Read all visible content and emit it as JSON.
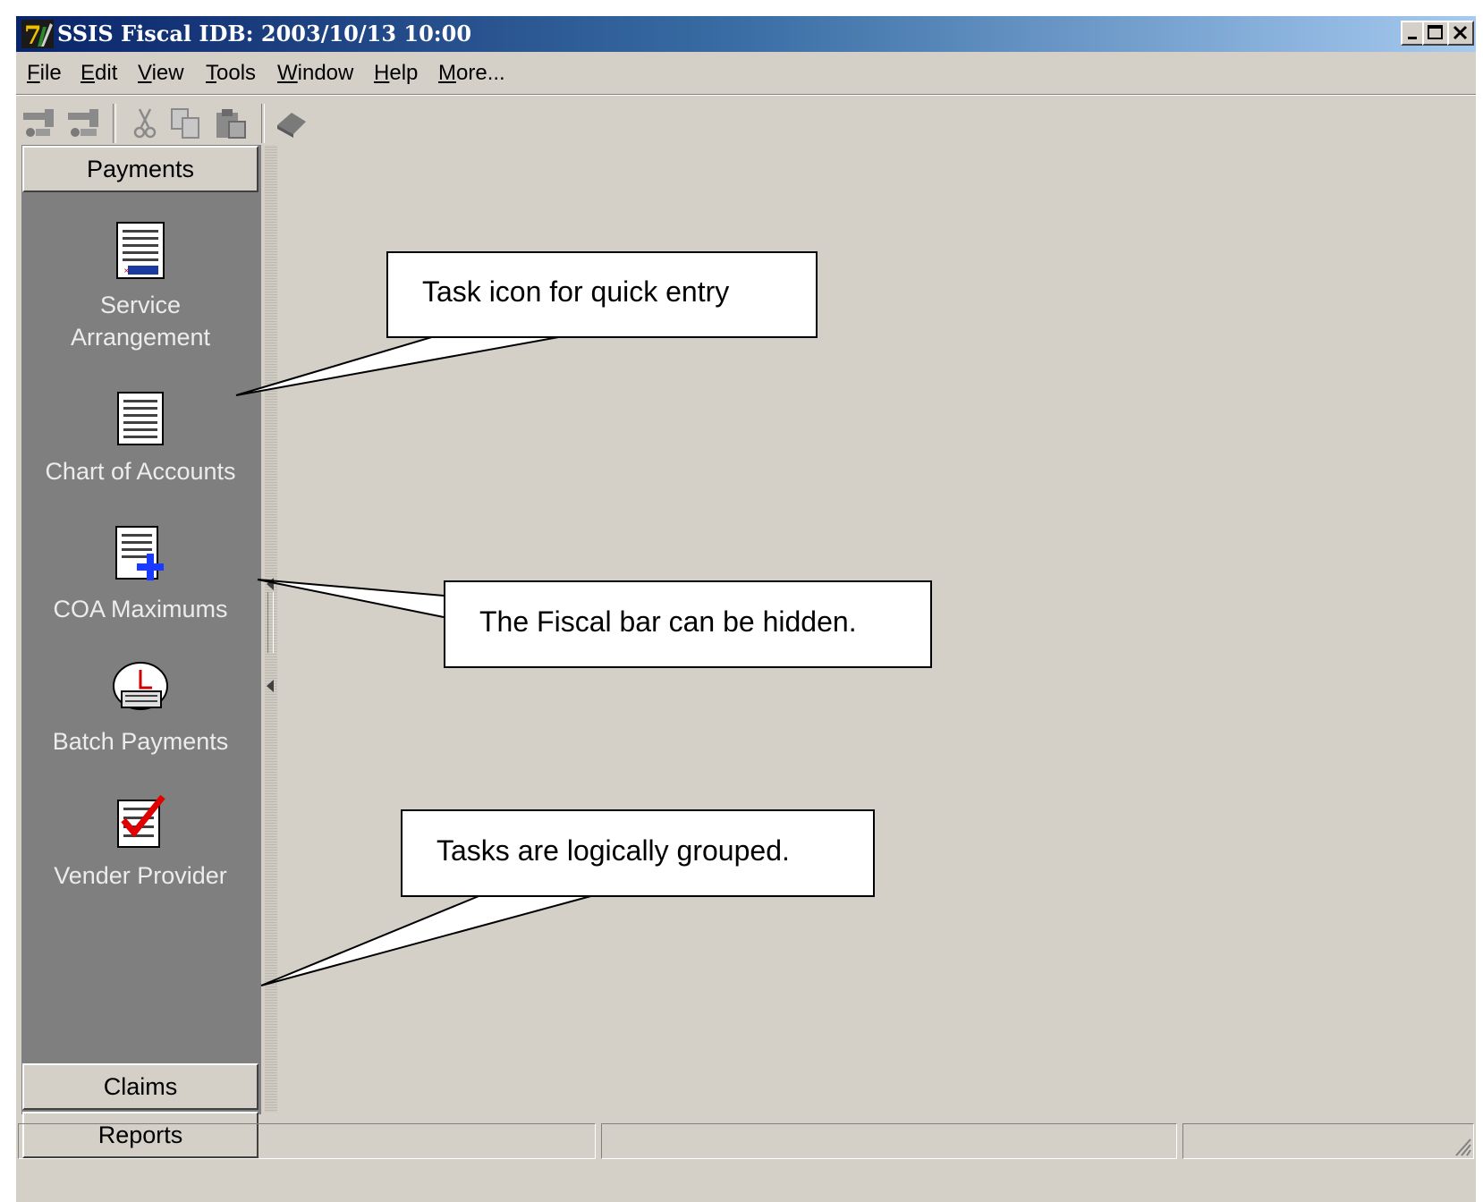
{
  "window": {
    "title": "SSIS Fiscal  IDB: 2003/10/13 10:00",
    "controls": [
      "minimize-icon",
      "maximize-icon",
      "close-icon"
    ]
  },
  "menu": {
    "items": [
      {
        "label": "File",
        "underline": "F"
      },
      {
        "label": "Edit",
        "underline": "E"
      },
      {
        "label": "View",
        "underline": "V"
      },
      {
        "label": "Tools",
        "underline": "T"
      },
      {
        "label": "Window",
        "underline": "W"
      },
      {
        "label": "Help",
        "underline": "H"
      },
      {
        "label": "More...",
        "underline": "M"
      }
    ]
  },
  "toolbar": {
    "icons": [
      "sign-on-icon",
      "sign-off-icon",
      "cut-icon",
      "copy-icon",
      "paste-icon",
      "eraser-icon"
    ]
  },
  "sidebar": {
    "active_group": "Payments",
    "tasks": [
      {
        "label_line1": "Service",
        "label_line2": "Arrangement",
        "icon": "service-arrangement-icon"
      },
      {
        "label_line1": "Chart of Accounts",
        "label_line2": "",
        "icon": "chart-of-accounts-icon"
      },
      {
        "label_line1": "COA Maximums",
        "label_line2": "",
        "icon": "coa-maximums-icon"
      },
      {
        "label_line1": "Batch Payments",
        "label_line2": "",
        "icon": "batch-payments-icon"
      },
      {
        "label_line1": "Vender Provider",
        "label_line2": "",
        "icon": "vender-provider-icon"
      }
    ],
    "other_groups": [
      "Claims",
      "Reports"
    ]
  },
  "callouts": [
    {
      "text": "Task icon for quick entry"
    },
    {
      "text": "The Fiscal bar can be hidden."
    },
    {
      "text": "Tasks are logically grouped."
    }
  ],
  "statusbar": {
    "panes": [
      "",
      "",
      ""
    ]
  }
}
